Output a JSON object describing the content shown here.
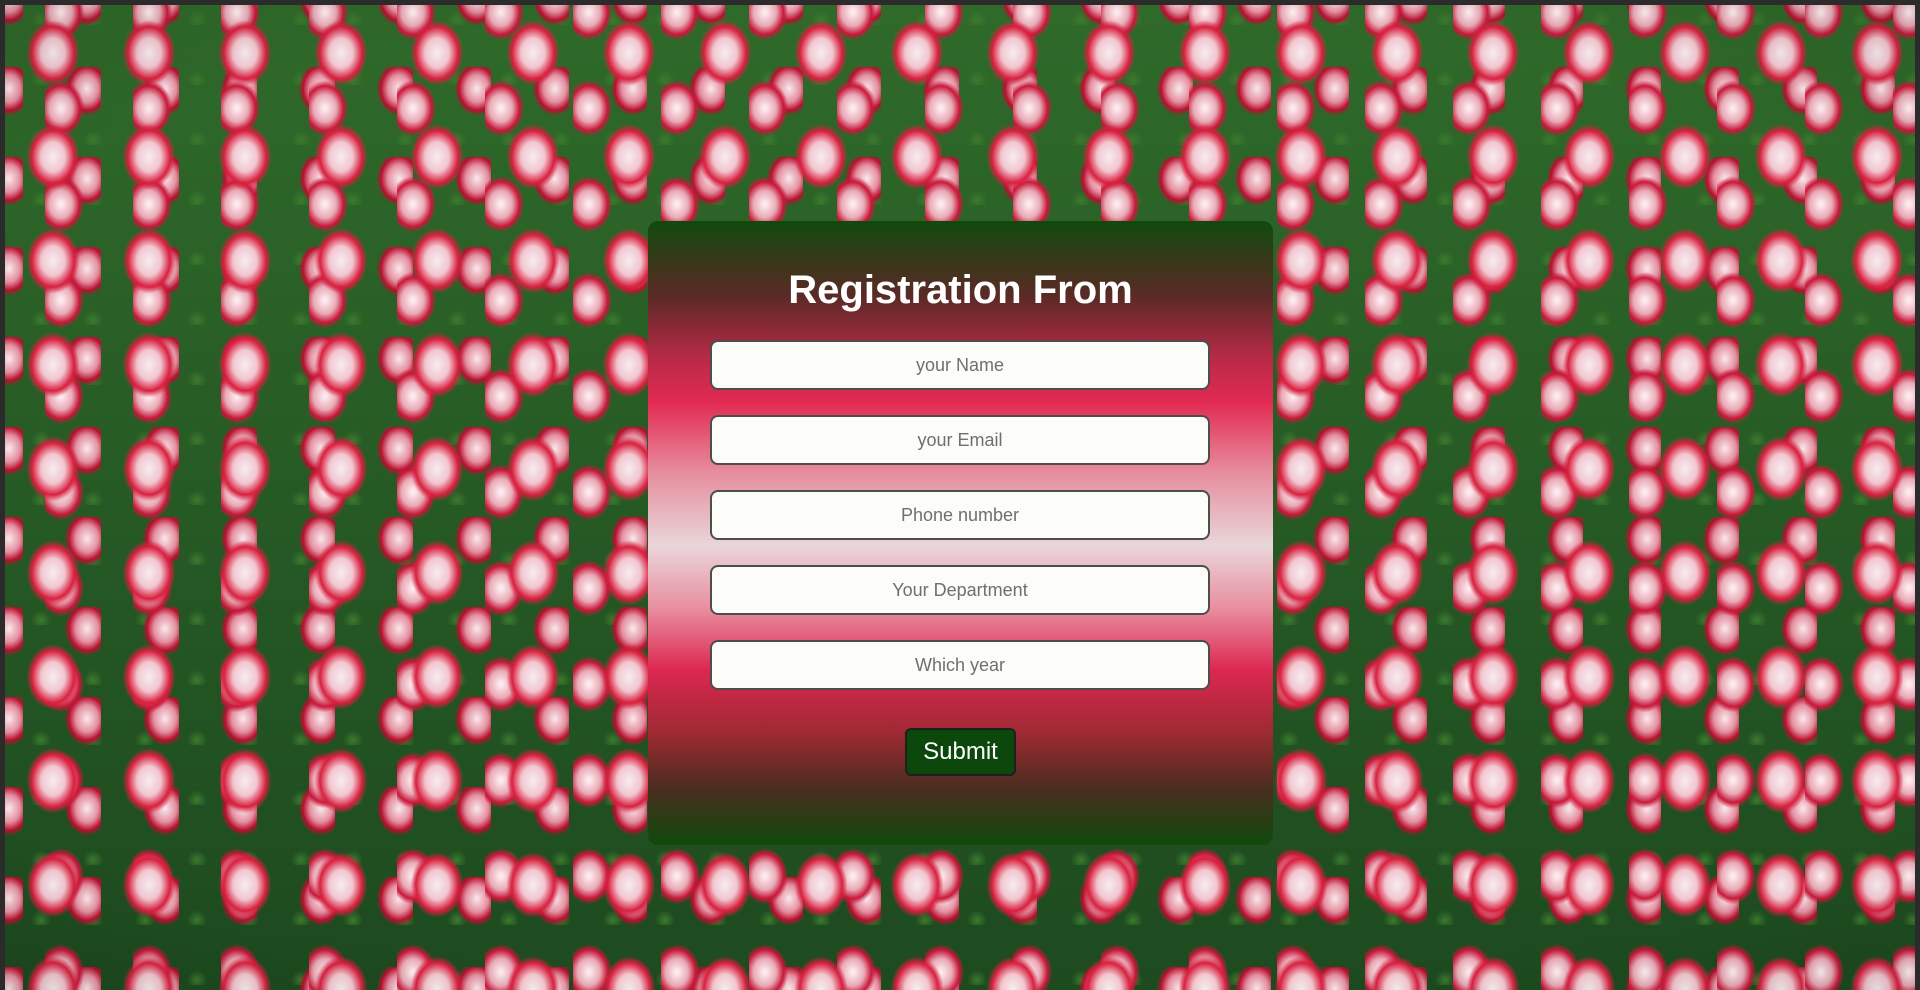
{
  "form": {
    "title": "Registration From",
    "fields": {
      "name": {
        "placeholder": "your Name",
        "value": ""
      },
      "email": {
        "placeholder": "your Email",
        "value": ""
      },
      "phone": {
        "placeholder": "Phone number",
        "value": ""
      },
      "department": {
        "placeholder": "Your Department",
        "value": ""
      },
      "year": {
        "placeholder": "Which year",
        "value": ""
      }
    },
    "submit_label": "Submit"
  },
  "colors": {
    "card_gradient_edge": "#0f4a0c",
    "card_gradient_accent": "#e22a52",
    "card_gradient_center": "#e9d6d9",
    "submit_background": "#0c470c",
    "field_background": "#fcfdf8"
  },
  "background": {
    "image_subject": "tulip-field-photo"
  }
}
